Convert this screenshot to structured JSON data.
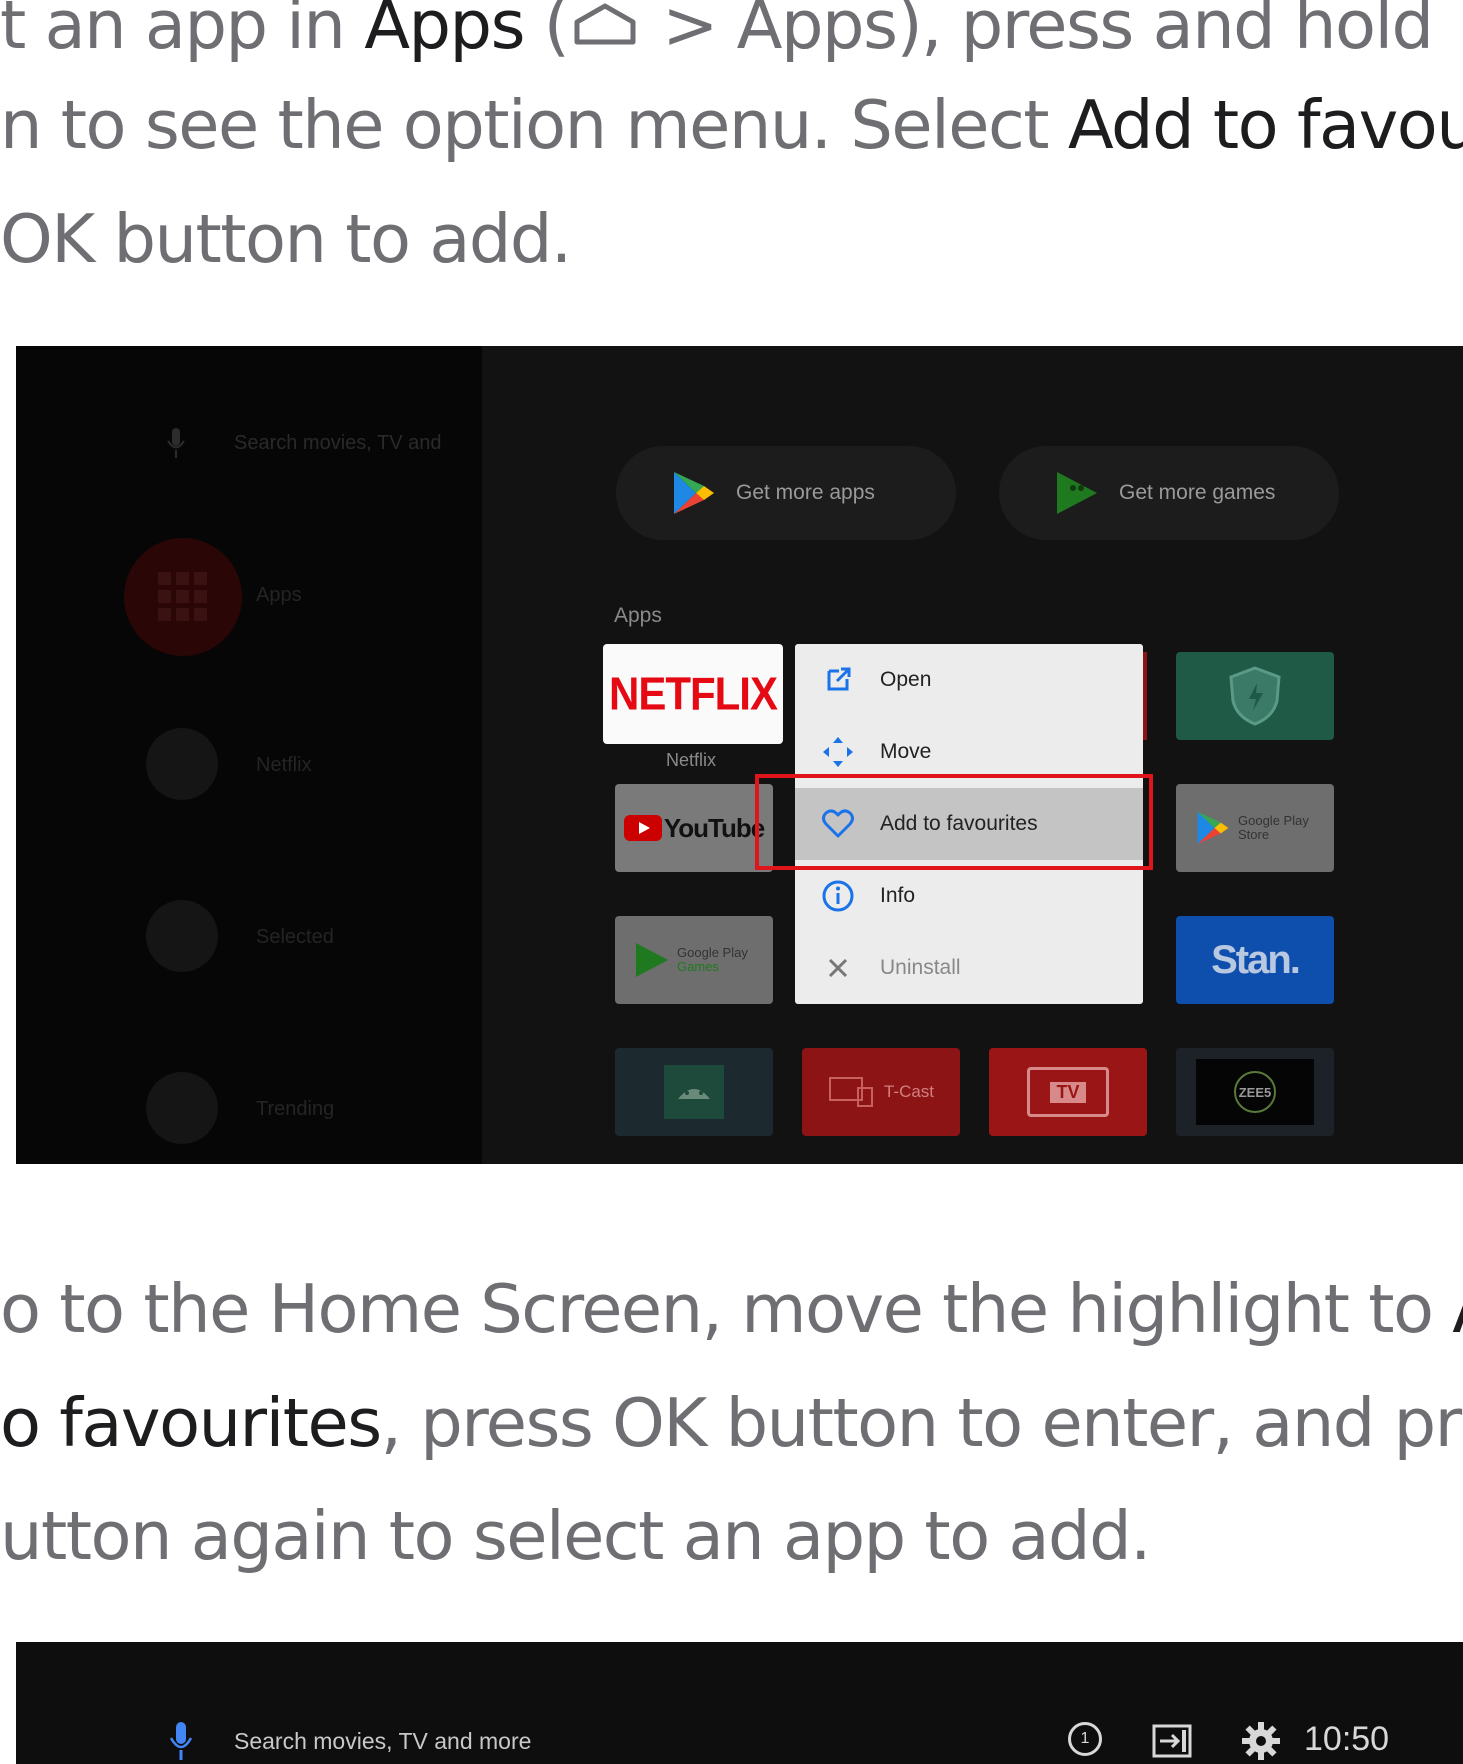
{
  "instructions": {
    "para1": {
      "line1": {
        "a": "t an app in ",
        "b": "Apps",
        "c": " (",
        "d": " > Apps), press and hold"
      },
      "line2": {
        "a": "n to see the option menu. Select ",
        "b": "Add to favou"
      },
      "line3": {
        "a": " OK button to add."
      }
    },
    "para2": {
      "line1": {
        "a": "o to the Home Screen, move the highlight to ",
        "b": "A"
      },
      "line2": {
        "a": "o favourites",
        "b": ", press OK button to enter, and pr"
      },
      "line3": {
        "a": "utton again to select an app to add."
      }
    }
  },
  "screenshot1": {
    "search_placeholder": "Search movies, TV and",
    "rail": {
      "apps": "Apps",
      "netflix": "Netflix",
      "selected": "Selected",
      "trending": "Trending"
    },
    "pills": {
      "more_apps": "Get more apps",
      "more_games": "Get more games"
    },
    "section_label": "Apps",
    "tiles": {
      "netflix": "NETFLIX",
      "netflix_caption": "Netflix",
      "youtube": "YouTube",
      "play_games": "Google Play",
      "play_games_sub": "Games",
      "play_store": "Google Play",
      "play_store_sub": "Store",
      "stan": "Stan.",
      "tcast": "T-Cast",
      "tv": "TV",
      "zee5": "ZEE5"
    },
    "menu": {
      "items": [
        {
          "label": "Open",
          "icon": "open-external-icon"
        },
        {
          "label": "Move",
          "icon": "move-arrows-icon"
        },
        {
          "label": "Add to favourites",
          "icon": "heart-icon"
        },
        {
          "label": "Info",
          "icon": "info-icon"
        },
        {
          "label": "Uninstall",
          "icon": "close-icon"
        }
      ],
      "highlight_color": "#e0151b",
      "accent_color": "#1a73e8"
    }
  },
  "screenshot2": {
    "search_placeholder": "Search movies, TV and more",
    "notification_count": "1",
    "time": "10:50"
  }
}
